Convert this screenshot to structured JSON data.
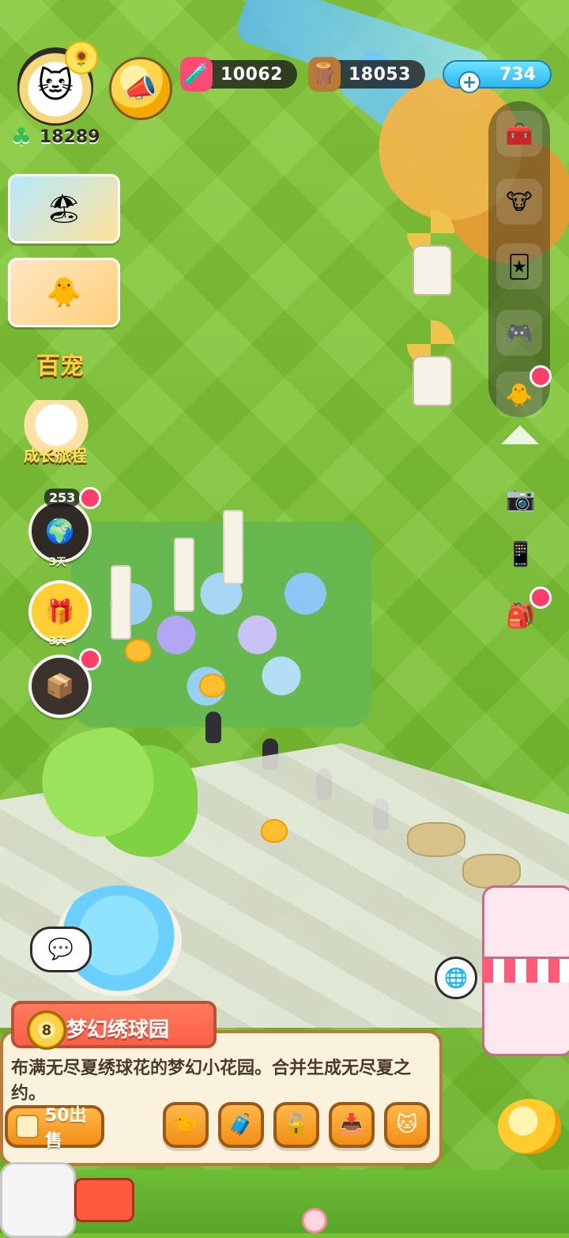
{
  "hud": {
    "player_clover_count": "18289",
    "resources": {
      "potion": "10062",
      "wood": "18053",
      "gems": "734"
    }
  },
  "left_column": {
    "event_label": "百宠",
    "growth_label": "成长旅程",
    "timer_count": "253",
    "days_left_1": "3天",
    "days_left_2": "3天"
  },
  "info_panel": {
    "level": "8",
    "title": "梦幻绣球园",
    "description": "布满无尽夏绣球花的梦幻小花园。合并生成无尽夏之约。",
    "sell_label": "50出售"
  },
  "icons": {
    "potion": "potion-jar-icon",
    "wood": "wood-log-icon",
    "gems": "gem-icon",
    "horn": "horn-icon",
    "clover": "clover-icon",
    "chat": "chat-icon",
    "globe": "globe-icon"
  },
  "colors": {
    "panel_bg": "#fbf2dd",
    "panel_border": "#b97a3a",
    "title_ribbon": "#ff5f4a",
    "button_orange": "#f28f16",
    "gem_blue": "#2fb4f2"
  }
}
